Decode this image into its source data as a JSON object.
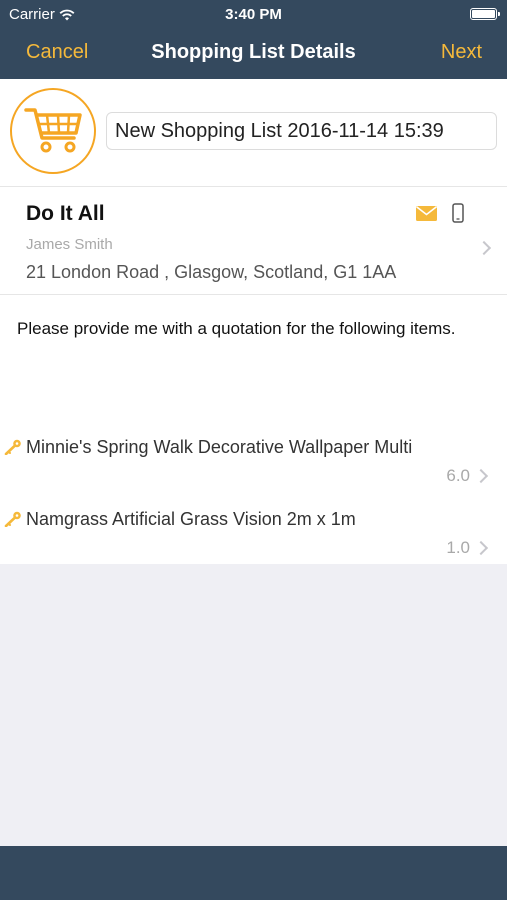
{
  "status_bar": {
    "carrier": "Carrier",
    "time": "3:40 PM"
  },
  "nav": {
    "cancel_label": "Cancel",
    "title": "Shopping List Details",
    "next_label": "Next"
  },
  "list": {
    "name": "New Shopping List 2016-11-14 15:39"
  },
  "supplier": {
    "name": "Do It All",
    "contact": "James Smith",
    "address": "21 London Road , Glasgow, Scotland, G1 1AA"
  },
  "message": "Please provide me with a quotation for the following items.",
  "items": [
    {
      "name": "Minnie's Spring Walk Decorative Wallpaper Multi",
      "quantity": "6.0"
    },
    {
      "name": "Namgrass Artificial Grass Vision 2m x 1m",
      "quantity": "1.0"
    }
  ],
  "colors": {
    "nav_bg": "#34495e",
    "accent": "#f5b93b",
    "cart_orange": "#f5a623",
    "background": "#efeff4"
  },
  "icons": {
    "cart": "shopping-cart-icon",
    "mail": "mail-icon",
    "phone": "mobile-phone-icon",
    "item": "key-icon"
  }
}
